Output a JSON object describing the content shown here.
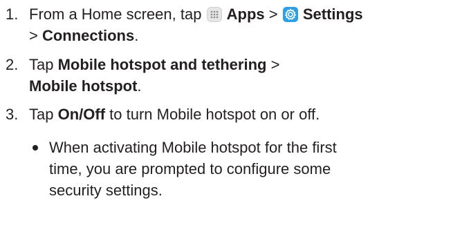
{
  "steps": [
    {
      "number": "1.",
      "prefix": "From a Home screen, tap ",
      "apps_label": "Apps",
      "separator_1": " > ",
      "settings_label": "Settings",
      "separator_2": "> ",
      "connections_label": "Connections",
      "suffix": "."
    },
    {
      "number": "2.",
      "prefix": "Tap ",
      "hotspot_tethering_label": "Mobile hotspot and tethering",
      "separator": " >",
      "mobile_hotspot_label": "Mobile hotspot",
      "suffix": "."
    },
    {
      "number": "3.",
      "prefix": "Tap ",
      "on_off_label": "On/Off",
      "suffix": " to turn Mobile hotspot on or off."
    }
  ],
  "bullet": {
    "text": "When activating Mobile hotspot for the first time, you are prompted to configure some security settings."
  },
  "icons": {
    "apps": "apps-grid-icon",
    "settings": "settings-gear-icon",
    "settings_color": "#2e9fe4",
    "apps_color": "#e6e6e6"
  }
}
